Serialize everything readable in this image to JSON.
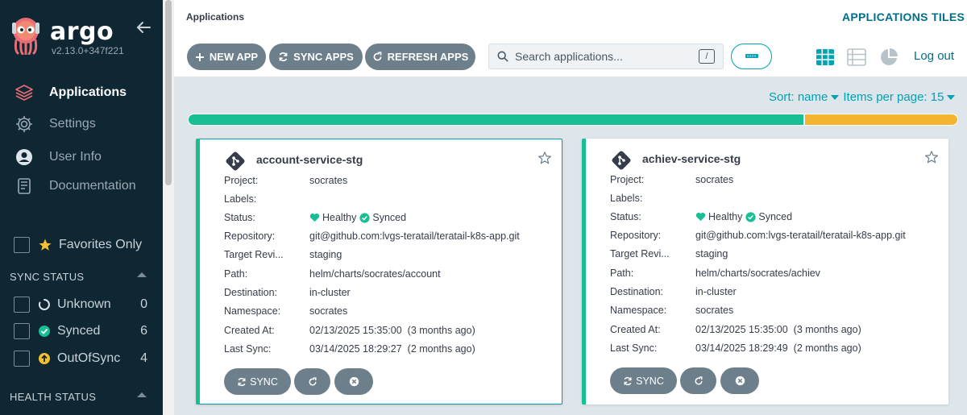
{
  "brand": {
    "name": "argo",
    "version": "v2.13.0+347f221"
  },
  "nav": [
    {
      "label": "Applications",
      "icon": "layers-icon",
      "active": true
    },
    {
      "label": "Settings",
      "icon": "gear-icon",
      "active": false
    },
    {
      "label": "User Info",
      "icon": "user-icon",
      "active": false
    },
    {
      "label": "Documentation",
      "icon": "book-icon",
      "active": false
    }
  ],
  "favorites_label": "Favorites Only",
  "sync_status": {
    "title": "SYNC STATUS",
    "items": [
      {
        "label": "Unknown",
        "count": "0"
      },
      {
        "label": "Synced",
        "count": "6"
      },
      {
        "label": "OutOfSync",
        "count": "4"
      }
    ]
  },
  "health_status": {
    "title": "HEALTH STATUS"
  },
  "header": {
    "page_title": "Applications",
    "view_title": "APPLICATIONS TILES",
    "new_app": "NEW APP",
    "sync_apps": "SYNC APPS",
    "refresh_apps": "REFRESH APPS",
    "search_placeholder": "Search applications...",
    "search_shortcut": "/",
    "logout": "Log out"
  },
  "sort": {
    "sort_label": "Sort: name",
    "per_page_label": "Items per page: 15"
  },
  "health_summary": {
    "healthy_fraction": 0.8,
    "other_fraction": 0.2
  },
  "colors": {
    "healthy": "#18be94",
    "warning": "#f4b631",
    "accent": "#00a2b3"
  },
  "field_labels": {
    "project": "Project:",
    "labels": "Labels:",
    "status": "Status:",
    "repository": "Repository:",
    "target_revision": "Target Revi...",
    "path": "Path:",
    "destination": "Destination:",
    "namespace": "Namespace:",
    "created_at": "Created At:",
    "last_sync": "Last Sync:"
  },
  "card_actions": {
    "sync": "SYNC"
  },
  "apps": [
    {
      "name": "account-service-stg",
      "project": "socrates",
      "labels": "",
      "health": "Healthy",
      "sync": "Synced",
      "repository": "git@github.com:lvgs-teratail/teratail-k8s-app.git",
      "target_revision": "staging",
      "path": "helm/charts/socrates/account",
      "destination": "in-cluster",
      "namespace": "socrates",
      "created_at": "02/13/2025 15:35:00",
      "created_ago": "(3 months ago)",
      "last_sync": "03/14/2025 18:29:27",
      "last_sync_ago": "(2 months ago)"
    },
    {
      "name": "achiev-service-stg",
      "project": "socrates",
      "labels": "",
      "health": "Healthy",
      "sync": "Synced",
      "repository": "git@github.com:lvgs-teratail/teratail-k8s-app.git",
      "target_revision": "staging",
      "path": "helm/charts/socrates/achiev",
      "destination": "in-cluster",
      "namespace": "socrates",
      "created_at": "02/13/2025 15:35:00",
      "created_ago": "(3 months ago)",
      "last_sync": "03/14/2025 18:29:49",
      "last_sync_ago": "(2 months ago)"
    }
  ]
}
